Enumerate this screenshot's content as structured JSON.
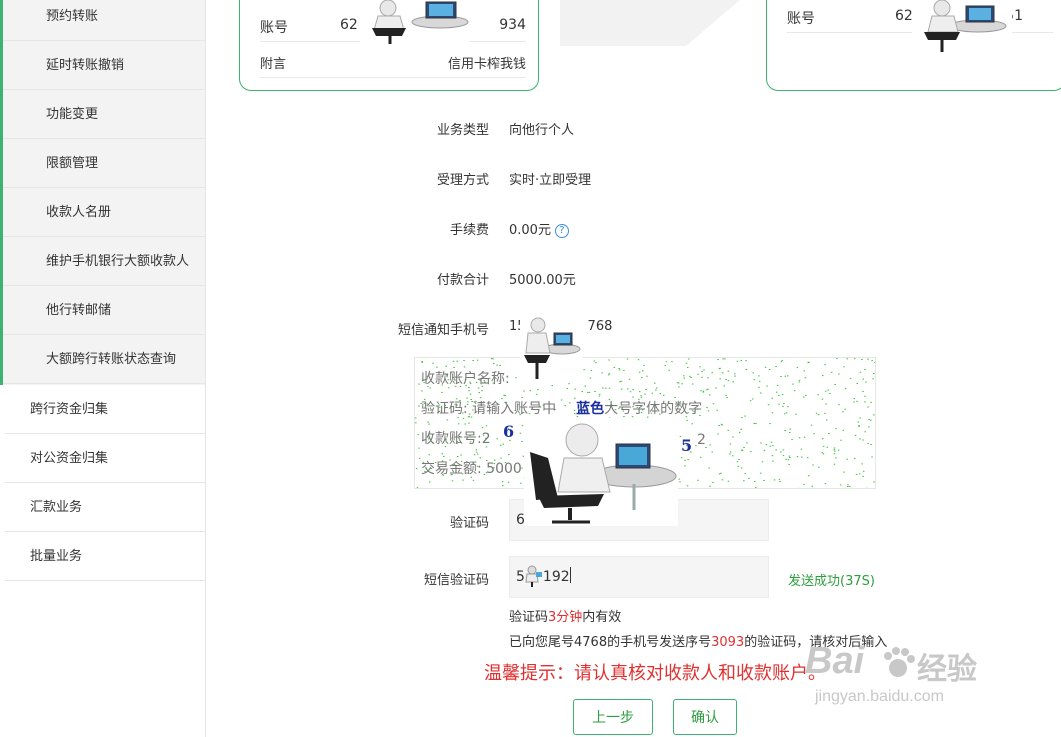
{
  "sidebar": {
    "sub_items": [
      {
        "label": "预约转账"
      },
      {
        "label": "延时转账撤销"
      },
      {
        "label": "功能变更"
      },
      {
        "label": "限额管理"
      },
      {
        "label": "收款人名册"
      },
      {
        "label": "维护手机银行大额收款人"
      },
      {
        "label": "他行转邮储"
      },
      {
        "label": "大额跨行转账状态查询"
      }
    ],
    "main_items": [
      {
        "label": "跨行资金归集"
      },
      {
        "label": "对公资金归集"
      },
      {
        "label": "汇款业务"
      },
      {
        "label": "批量业务"
      }
    ]
  },
  "payer_card": {
    "account_label": "账号",
    "account_prefix": "62",
    "account_suffix": "934",
    "memo_label": "附言",
    "memo_value": "信用卡榨我钱"
  },
  "payee_card": {
    "account_label": "账号",
    "account_prefix": "62",
    "account_suffix": "951"
  },
  "form": {
    "business_type_label": "业务类型",
    "business_type_value": "向他行个人",
    "processing_label": "受理方式",
    "processing_value": "实时·立即受理",
    "fee_label": "手续费",
    "fee_value": "0.00元",
    "fee_help_icon": "?",
    "total_label": "付款合计",
    "total_value": "5000.00元",
    "sms_phone_label": "短信通知手机号",
    "sms_phone_prefix": "15",
    "sms_phone_suffix": "768"
  },
  "captcha": {
    "line1": "收款账户名称:",
    "line2_a": "验证码: 请输入账号中",
    "line2_blue": "蓝色",
    "line2_b": "大号字体的数字",
    "line3": "收款账号:",
    "line3_digit1": "2",
    "line3_digit_end": "2",
    "line3_blue1": "6",
    "line3_blue2": "5",
    "line4": "交易金额: 5000"
  },
  "verify": {
    "code_label": "验证码",
    "code_value": "62",
    "sms_code_label": "短信验证码",
    "sms_code_prefix": "5",
    "sms_code_suffix": "192",
    "send_status": "发送成功(37S)",
    "hint1_a": "验证码",
    "hint1_red": "3分钟",
    "hint1_b": "内有效",
    "hint2_a": "已向您尾号4768的手机号发送序号",
    "hint2_red": "3093",
    "hint2_b": "的验证码，请核对后输入",
    "warning": "温馨提示：请认真核对收款人和收款账户。"
  },
  "buttons": {
    "prev": "上一步",
    "confirm": "确认"
  },
  "watermark": {
    "brand": "Bai",
    "brand_cn": "经验",
    "url": "jingyan.baidu.com"
  },
  "colors": {
    "accent": "#3cb371",
    "text_green": "#2e9e3e",
    "red": "#e03030",
    "captcha_blue": "#1a2fa0"
  }
}
